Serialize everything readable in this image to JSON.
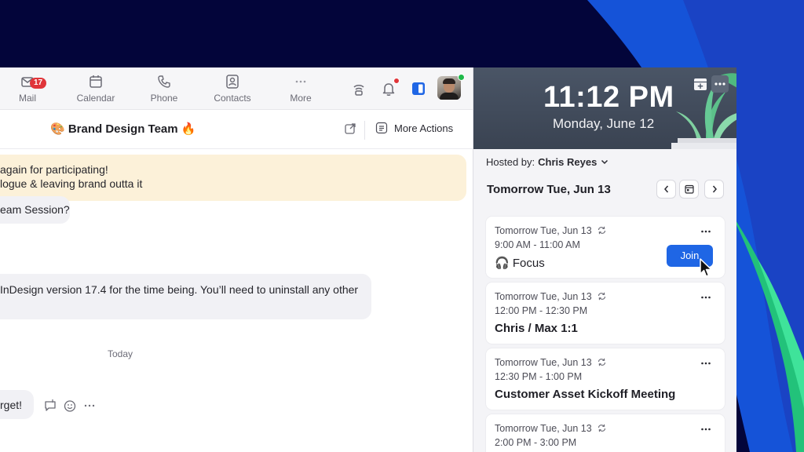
{
  "nav": {
    "items": [
      {
        "label": "Mail",
        "badge": "17"
      },
      {
        "label": "Calendar"
      },
      {
        "label": "Phone"
      },
      {
        "label": "Contacts"
      },
      {
        "label": "More"
      }
    ]
  },
  "chat": {
    "title": "🎨 Brand Design Team 🔥",
    "more_actions": "More Actions",
    "messages": [
      {
        "line1": "again for participating!",
        "line2": "logue & leaving brand outta it"
      },
      {
        "line1": "eam Session?"
      },
      {
        "line1": "InDesign version 17.4 for the time being. You’ll need to uninstall any other"
      },
      {
        "line1": "rget!"
      }
    ],
    "today_label": "Today"
  },
  "calendar": {
    "time": "11:12 PM",
    "date": "Monday, June 12",
    "hosted_label": "Hosted by:",
    "host": "Chris Reyes",
    "day_title": "Tomorrow Tue, Jun 13",
    "events": [
      {
        "date": "Tomorrow Tue, Jun 13",
        "time": "9:00 AM - 11:00 AM",
        "title": "🎧 Focus",
        "join": "Join"
      },
      {
        "date": "Tomorrow Tue, Jun 13",
        "time": "12:00 PM - 12:30 PM",
        "title": "Chris / Max 1:1"
      },
      {
        "date": "Tomorrow Tue, Jun 13",
        "time": "12:30 PM - 1:00 PM",
        "title": "Customer Asset Kickoff Meeting"
      },
      {
        "date": "Tomorrow Tue, Jun 13",
        "time": "2:00 PM - 3:00 PM"
      }
    ]
  },
  "colors": {
    "background": "#03053a",
    "accent_blue": "#1f66e5",
    "highlight": "#fcf1d9",
    "badge_red": "#e0353a",
    "online_green": "#1fb94a"
  }
}
